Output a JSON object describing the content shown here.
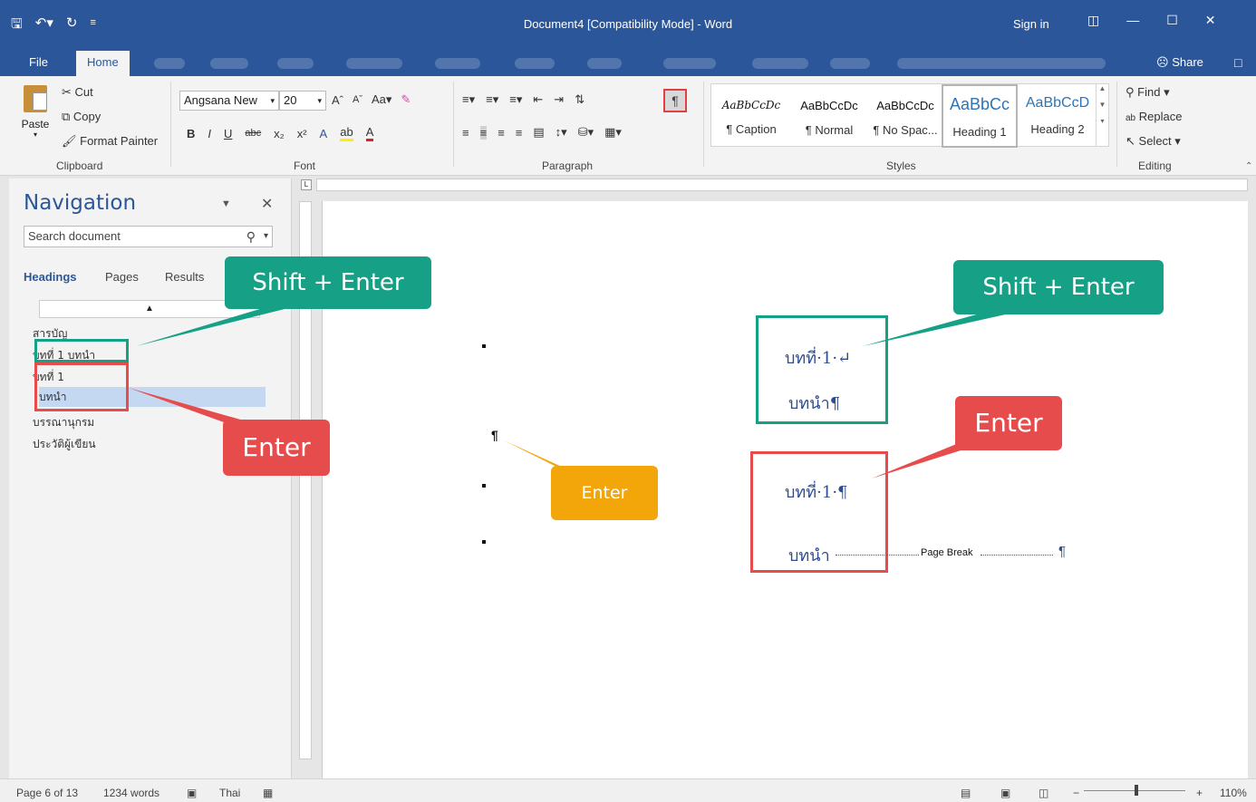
{
  "titlebar": {
    "save_icon": "save-icon",
    "undo_icon": "undo-icon",
    "redo_icon": "redo-icon",
    "title": "Document4 [Compatibility Mode]  -  Word",
    "signin": "Sign in"
  },
  "tabs": {
    "file": "File",
    "home": "Home",
    "share": "Share"
  },
  "clipboard": {
    "paste": "Paste",
    "cut": "Cut",
    "copy": "Copy",
    "format_painter": "Format Painter",
    "label": "Clipboard"
  },
  "font": {
    "name": "Angsana New",
    "size": "20",
    "label": "Font",
    "case_btn": "Aa"
  },
  "paragraph": {
    "label": "Paragraph",
    "show_marks": "¶"
  },
  "styles": {
    "label": "Styles",
    "items": [
      {
        "sample": "AaBbCcDc",
        "name": "¶ Caption"
      },
      {
        "sample": "AaBbCcDc",
        "name": "¶ Normal"
      },
      {
        "sample": "AaBbCcDc",
        "name": "¶ No Spac..."
      },
      {
        "sample": "AaBbCc",
        "name": "Heading 1"
      },
      {
        "sample": "AaBbCcD",
        "name": "Heading 2"
      }
    ]
  },
  "editing": {
    "find": "Find",
    "replace": "Replace",
    "select": "Select",
    "label": "Editing"
  },
  "nav": {
    "title": "Navigation",
    "search_placeholder": "Search document",
    "tabs": [
      "Headings",
      "Pages",
      "Results"
    ],
    "headings": [
      "สารบัญ",
      "บทที่ 1  บทนำ",
      "บทที่ 1",
      "บทนำ",
      "บรรณานุกรม",
      "ประวัติผู้เขียน"
    ]
  },
  "doc": {
    "pilcrow": "¶",
    "line1": "บทที่·1·↵",
    "line2": "บทนำ¶",
    "line3": "บทที่·1·¶",
    "line4": "บทนำ",
    "page_break": "Page Break",
    "page_break_mark": "¶"
  },
  "callouts": {
    "nav_shift": "Shift + Enter",
    "nav_enter": "Enter",
    "doc_enter": "Enter",
    "doc_shift": "Shift + Enter",
    "doc_enter2": "Enter"
  },
  "status": {
    "page": "Page 6 of 13",
    "words": "1234 words",
    "lang": "Thai",
    "zoom": "110%"
  },
  "colors": {
    "brand": "#2b579a",
    "green": "#16a085",
    "red": "#e74c4c",
    "orange": "#f2a60a"
  }
}
